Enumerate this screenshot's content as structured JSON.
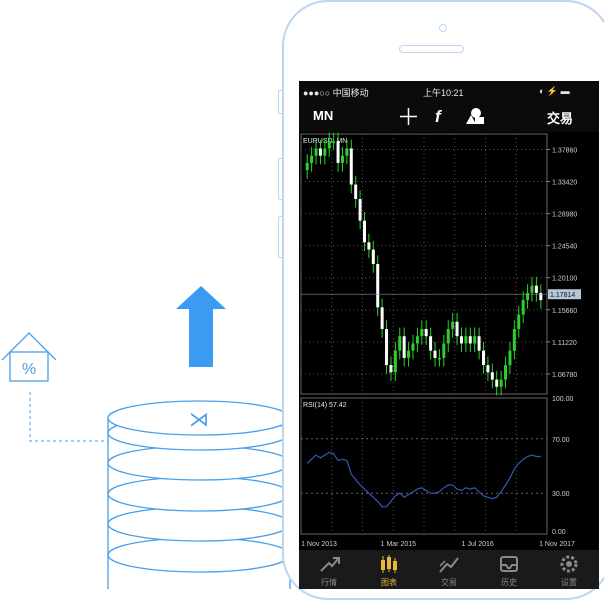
{
  "status": {
    "carrier": "●●●○○ 中国移动",
    "time": "上午10:21",
    "battery": "◐ ⚡ ▬"
  },
  "toolbar": {
    "timeframe": "MN",
    "crosshair_icon": "crosshair-icon",
    "indicator_icon": "function-icon",
    "objects_icon": "objects-icon",
    "trade_label": "交易"
  },
  "chart": {
    "symbol_label": "EURUSD, MN",
    "price_ticks": [
      "1.37860",
      "1.33420",
      "1.28980",
      "1.24540",
      "1.20100",
      "1.15660",
      "1.11220",
      "1.06780"
    ],
    "current_price": "1.17814",
    "rsi_label": "RSI(14) 57.42",
    "rsi_ticks": [
      "100.00",
      "70.00",
      "30.00",
      "0.00"
    ],
    "date_labels": [
      "1 Nov 2013",
      "1 Mar 2015",
      "1 Jul 2016",
      "1 Nov 2017"
    ]
  },
  "colors": {
    "up_candle": "#2bd12b",
    "down_candle": "#ffffff",
    "rsi_line": "#2f5bb0",
    "price_tag": "#b9c6d6",
    "active_tab": "#e6b83a",
    "inactive_tab": "#8a8a8a",
    "outline": "#4a9fea"
  },
  "nav": [
    {
      "label": "行情",
      "icon": "quotes-icon"
    },
    {
      "label": "图表",
      "icon": "chart-icon",
      "active": true
    },
    {
      "label": "交易",
      "icon": "trade-icon"
    },
    {
      "label": "历史",
      "icon": "history-icon"
    },
    {
      "label": "设置",
      "icon": "settings-icon"
    }
  ],
  "illustration": {
    "house_symbol": "%",
    "coin_symbol": "⋊"
  },
  "chart_data": {
    "type": "candlestick",
    "symbol": "EURUSD, MN",
    "x_range": [
      "2013-11",
      "2017-11"
    ],
    "ylim": [
      1.04,
      1.4
    ],
    "closes": [
      1.36,
      1.37,
      1.38,
      1.37,
      1.38,
      1.39,
      1.39,
      1.36,
      1.37,
      1.38,
      1.33,
      1.31,
      1.28,
      1.25,
      1.24,
      1.22,
      1.16,
      1.13,
      1.08,
      1.07,
      1.1,
      1.12,
      1.09,
      1.1,
      1.11,
      1.12,
      1.13,
      1.12,
      1.1,
      1.09,
      1.09,
      1.11,
      1.13,
      1.14,
      1.12,
      1.11,
      1.12,
      1.11,
      1.12,
      1.1,
      1.08,
      1.07,
      1.06,
      1.05,
      1.06,
      1.08,
      1.1,
      1.13,
      1.15,
      1.17,
      1.18,
      1.19,
      1.18,
      1.17
    ],
    "rsi": [
      52,
      55,
      58,
      56,
      58,
      60,
      59,
      54,
      55,
      54,
      44,
      40,
      36,
      33,
      30,
      27,
      24,
      20,
      20,
      24,
      28,
      30,
      27,
      29,
      31,
      33,
      34,
      32,
      30,
      30,
      31,
      34,
      36,
      36,
      33,
      32,
      34,
      33,
      34,
      31,
      28,
      27,
      26,
      27,
      31,
      36,
      41,
      48,
      52,
      55,
      57,
      58,
      57,
      57
    ],
    "rsi_ylim": [
      0,
      100
    ],
    "rsi_levels": [
      30,
      70
    ]
  }
}
